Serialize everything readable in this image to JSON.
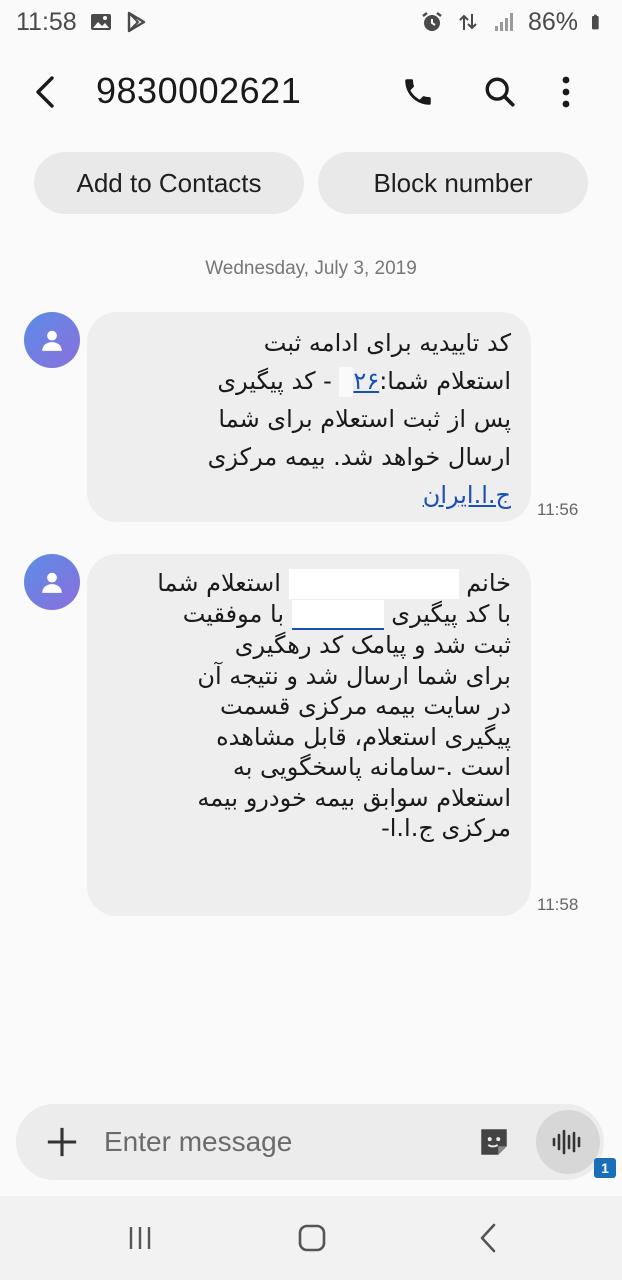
{
  "status_bar": {
    "time": "11:58",
    "battery": "86%",
    "left_icons": [
      "gallery-icon",
      "play-store-icon"
    ],
    "right_icons": [
      "alarm-icon",
      "data-arrows-icon",
      "signal-icon",
      "battery-icon"
    ]
  },
  "app_bar": {
    "title": "9830002621",
    "actions": [
      "phone-icon",
      "search-icon",
      "more-icon"
    ]
  },
  "actions": {
    "add_contacts": "Add to Contacts",
    "block_number": "Block number"
  },
  "date_separator": "Wednesday, July 3, 2019",
  "messages": [
    {
      "time": "11:56",
      "lines": [
        "کد تاییدیه  برای ادامه ثبت",
        "استعلام شما:",
        "۲۶",
        "-  کد پیگیری",
        "پس از ثبت استعلام برای شما",
        "ارسال خواهد شد. بیمه مرکزی",
        "ج.ا.ایران"
      ]
    },
    {
      "time": "11:58",
      "lines": [
        "خانم",
        "استعلام شما",
        "با کد پیگیری",
        "با موفقیت",
        "ثبت شد و پیامک کد رهگیری",
        "برای شما ارسال شد و نتیجه آن",
        "در سایت بیمه مرکزی قسمت",
        "پیگیری استعلام، قابل مشاهده",
        "است .-سامانه پاسخگویی به",
        "استعلام سوابق بیمه خودرو  بیمه",
        "مرکزی ج.ا.ا-"
      ]
    }
  ],
  "input": {
    "placeholder": "Enter message",
    "sim_badge": "1"
  },
  "nav": [
    "recent-apps-icon",
    "home-icon",
    "back-icon"
  ]
}
